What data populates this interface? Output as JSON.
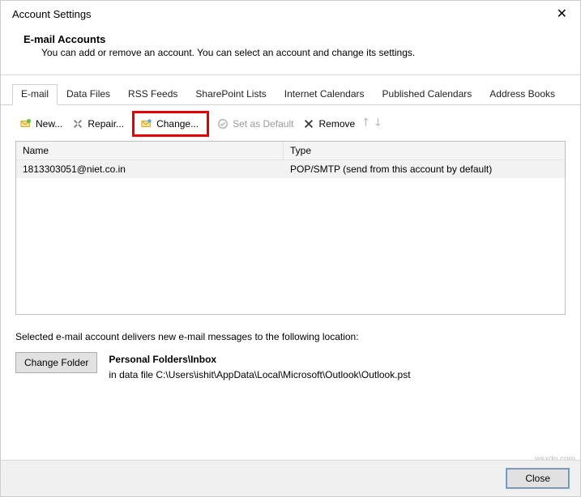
{
  "window": {
    "title": "Account Settings"
  },
  "header": {
    "title": "E-mail Accounts",
    "subtitle": "You can add or remove an account. You can select an account and change its settings."
  },
  "tabs": {
    "t0": "E-mail",
    "t1": "Data Files",
    "t2": "RSS Feeds",
    "t3": "SharePoint Lists",
    "t4": "Internet Calendars",
    "t5": "Published Calendars",
    "t6": "Address Books"
  },
  "toolbar": {
    "new": "New...",
    "repair": "Repair...",
    "change": "Change...",
    "default": "Set as Default",
    "remove": "Remove"
  },
  "list": {
    "col_name": "Name",
    "col_type": "Type",
    "row0_name": "1813303051@niet.co.in",
    "row0_type": "POP/SMTP (send from this account by default)"
  },
  "delivery": {
    "text": "Selected e-mail account delivers new e-mail messages to the following location:",
    "change_folder": "Change Folder",
    "location_title": "Personal Folders\\Inbox",
    "location_path": "in data file C:\\Users\\ishit\\AppData\\Local\\Microsoft\\Outlook\\Outlook.pst"
  },
  "footer": {
    "close": "Close"
  },
  "watermark": "wsxdn.com"
}
